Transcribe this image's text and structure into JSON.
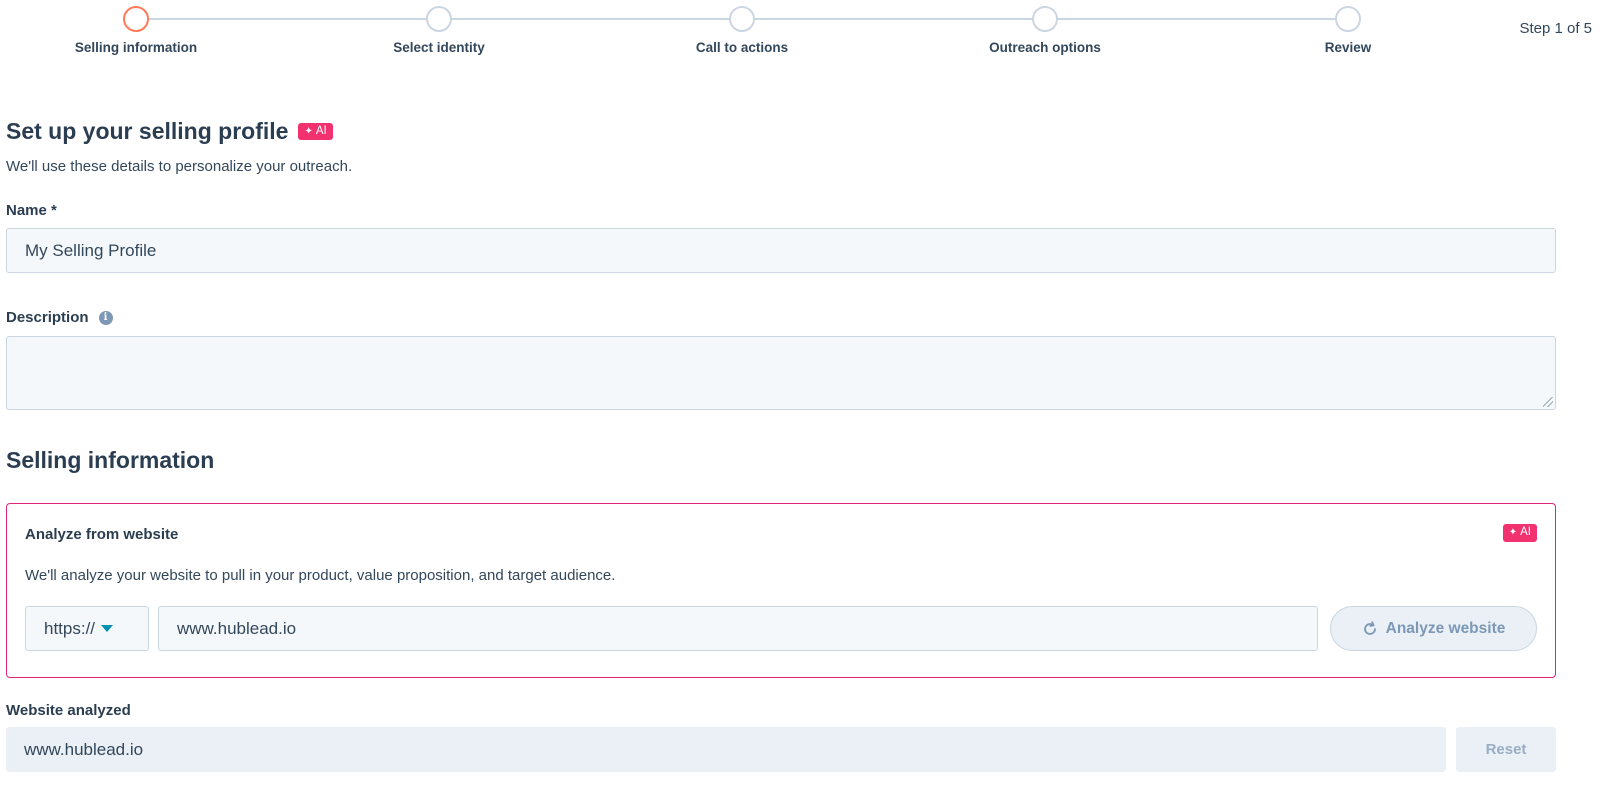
{
  "stepper": {
    "steps": [
      {
        "label": "Selling information",
        "active": true
      },
      {
        "label": "Select identity",
        "active": false
      },
      {
        "label": "Call to actions",
        "active": false
      },
      {
        "label": "Outreach options",
        "active": false
      },
      {
        "label": "Review",
        "active": false
      }
    ],
    "counter": "Step 1 of 5",
    "active_color": "#ff7a59"
  },
  "profile": {
    "title": "Set up your selling profile",
    "ai_badge": "AI",
    "subtitle": "We'll use these details to personalize your outreach."
  },
  "name_field": {
    "label": "Name *",
    "value": "My Selling Profile"
  },
  "description_field": {
    "label": "Description",
    "info_icon": "info-icon",
    "value": ""
  },
  "selling_section": {
    "title": "Selling information"
  },
  "analyze_card": {
    "title": "Analyze from website",
    "ai_badge": "AI",
    "description": "We'll analyze your website to pull in your product, value proposition, and target audience.",
    "protocol": "https://",
    "url": "www.hublead.io",
    "button_label": "Analyze website",
    "button_icon": "refresh-icon",
    "border_color": "#e0237a"
  },
  "website_analyzed": {
    "label": "Website analyzed",
    "value": "www.hublead.io",
    "reset_label": "Reset"
  },
  "colors": {
    "ai_badge": "#f2316f",
    "text": "#33475b",
    "input_bg": "#f5f8fa"
  }
}
